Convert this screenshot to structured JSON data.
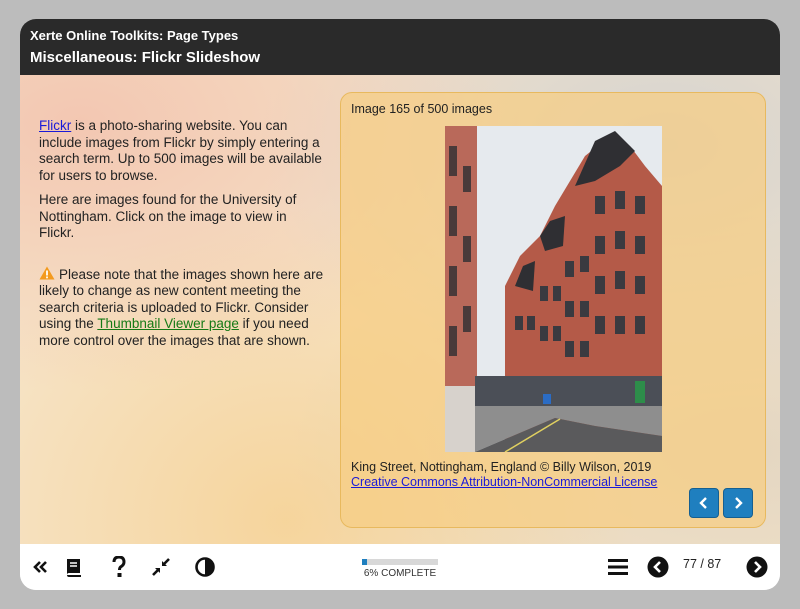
{
  "header": {
    "course_title": "Xerte Online Toolkits: Page Types",
    "page_title": "Miscellaneous: Flickr Slideshow"
  },
  "text": {
    "p1_link": "Flickr",
    "p1_rest": " is a photo-sharing website. You can include images from Flickr by simply entering a search term. Up to 500 images will be available for users to browse.",
    "p2": "Here are images found for the University of Nottingham. Click on the image to view in Flickr.",
    "note_pre": "Please note that the images shown here are likely to change as new content meeting the search criteria is uploaded to Flickr. Consider using the ",
    "note_link": "Thumbnail Viewer page",
    "note_post": " if you need more control over the images that are shown."
  },
  "slideshow": {
    "counter": "Image 165 of 500 images",
    "caption": "King Street, Nottingham, England © Billy Wilson, 2019",
    "license": "Creative Commons Attribution-NonCommercial License",
    "prev_icon": "chevron-left-icon",
    "next_icon": "chevron-right-icon"
  },
  "footer": {
    "progress_label": "6% COMPLETE",
    "progress_percent": 6,
    "page_indicator": "77 / 87",
    "icons": [
      "double-chevron-left-icon",
      "glossary-book-icon",
      "help-icon",
      "minimize-icon",
      "contrast-icon",
      "menu-icon",
      "previous-page-icon",
      "next-page-icon"
    ]
  },
  "colors": {
    "header_bg": "#2a2a2a",
    "accent": "#1f7fbf",
    "panel_bg": "#f6cd82",
    "link": "#1a1ad8",
    "link_green": "#167a16",
    "warning": "#f39a1e"
  }
}
